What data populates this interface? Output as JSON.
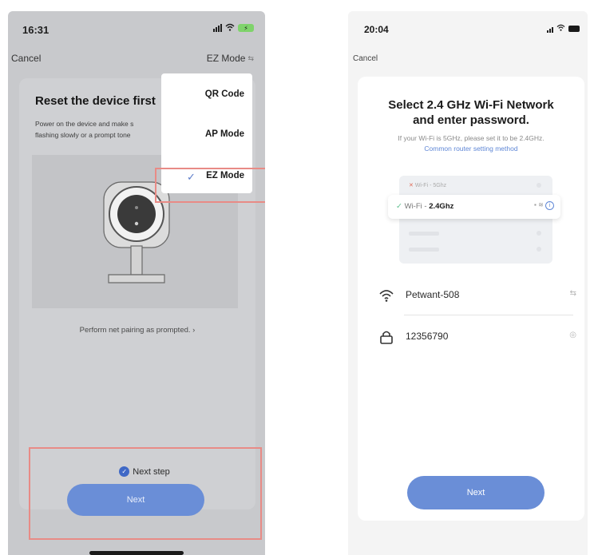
{
  "left_screen": {
    "status_time": "16:31",
    "nav": {
      "cancel": "Cancel",
      "mode": "EZ Mode"
    },
    "reset": {
      "title": "Reset the device first",
      "desc_line1": "Power on the device and make s",
      "desc_line2": "flashing slowly or a prompt tone"
    },
    "prompt_link": "Perform net pairing as prompted. ›",
    "dropdown": {
      "items": [
        "QR Code",
        "AP Mode",
        "EZ Mode"
      ],
      "selected": "EZ Mode"
    },
    "next_step_label": "Next step",
    "next_button": "Next"
  },
  "right_screen": {
    "status_time": "20:04",
    "nav": {
      "cancel": "Cancel"
    },
    "title_line1": "Select 2.4 GHz Wi-Fi Network",
    "title_line2": "and enter password.",
    "subtitle": "If your Wi-Fi is 5GHz, please set it to be 2.4GHz.",
    "link": "Common router setting method",
    "illustration": {
      "row_5g_prefix": "Wi-Fi - ",
      "row_5g_band": "5Ghz",
      "row_24_prefix": "Wi-Fi - ",
      "row_24_band": "2.4Ghz"
    },
    "wifi_name": "Petwant-508",
    "password": "12356790",
    "next_button": "Next"
  },
  "colors": {
    "accent_blue": "#6a8ed7",
    "highlight_red": "#e88b86",
    "link_blue": "#5f87d6"
  }
}
